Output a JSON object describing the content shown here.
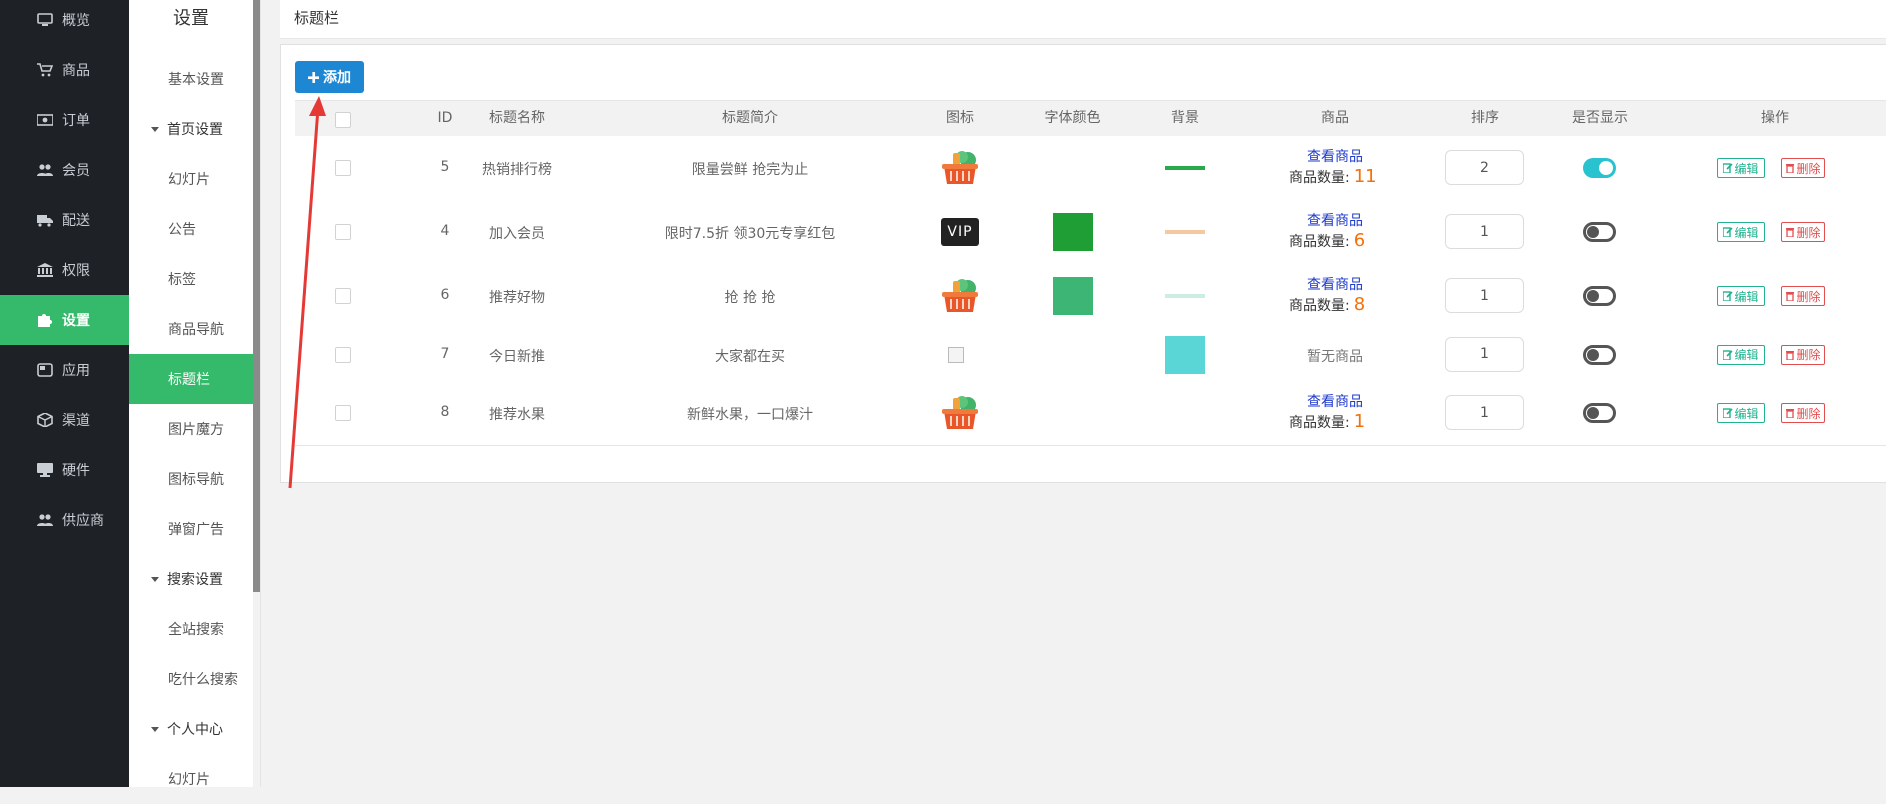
{
  "sidebar": {
    "items": [
      {
        "label": "概览",
        "icon": "monitor-icon"
      },
      {
        "label": "商品",
        "icon": "cart-icon"
      },
      {
        "label": "订单",
        "icon": "money-icon"
      },
      {
        "label": "会员",
        "icon": "users-icon"
      },
      {
        "label": "配送",
        "icon": "truck-icon"
      },
      {
        "label": "权限",
        "icon": "bank-icon"
      },
      {
        "label": "设置",
        "icon": "puzzle-icon",
        "active": true
      },
      {
        "label": "应用",
        "icon": "app-icon"
      },
      {
        "label": "渠道",
        "icon": "cube-icon"
      },
      {
        "label": "硬件",
        "icon": "desktop-icon"
      },
      {
        "label": "供应商",
        "icon": "users-icon"
      }
    ]
  },
  "subnav": {
    "title": "设置",
    "items": [
      {
        "label": "基本设置"
      },
      {
        "label": "首页设置",
        "group": true
      },
      {
        "label": "幻灯片"
      },
      {
        "label": "公告"
      },
      {
        "label": "标签"
      },
      {
        "label": "商品导航"
      },
      {
        "label": "标题栏",
        "active": true
      },
      {
        "label": "图片魔方"
      },
      {
        "label": "图标导航"
      },
      {
        "label": "弹窗广告"
      },
      {
        "label": "搜索设置",
        "group": true
      },
      {
        "label": "全站搜索"
      },
      {
        "label": "吃什么搜索"
      },
      {
        "label": "个人中心",
        "group": true
      },
      {
        "label": "幻灯片"
      }
    ]
  },
  "breadcrumb": "标题栏",
  "toolbar": {
    "add_label": "添加"
  },
  "table": {
    "headers": [
      "ID",
      "标题名称",
      "标题简介",
      "图标",
      "字体颜色",
      "背景",
      "商品",
      "排序",
      "是否显示",
      "操作"
    ],
    "view_goods_label": "查看商品",
    "goods_count_label": "商品数量:",
    "no_goods_label": "暂无商品",
    "edit_label": "编辑",
    "delete_label": "删除",
    "rows": [
      {
        "id": "5",
        "name": "热销排行榜",
        "desc": "限量尝鲜 抢完为止",
        "icon": "basket-icon",
        "font_color": null,
        "bg_color": "#2aa84a",
        "bg_style": "line",
        "goods_count": "11",
        "sort": "2",
        "show": true
      },
      {
        "id": "4",
        "name": "加入会员",
        "desc": "限时7.5折 领30元专享红包",
        "icon": "vip-icon",
        "icon_text": "VIP",
        "font_color": "#1f9e35",
        "bg_color": "#f4c9a0",
        "bg_style": "line",
        "goods_count": "6",
        "sort": "1",
        "show": false
      },
      {
        "id": "6",
        "name": "推荐好物",
        "desc": "抢 抢 抢",
        "icon": "basket-icon",
        "font_color": "#3db574",
        "bg_color": "#cbeee0",
        "bg_style": "line",
        "goods_count": "8",
        "sort": "1",
        "show": false
      },
      {
        "id": "7",
        "name": "今日新推",
        "desc": "大家都在买",
        "icon": "broken-image-icon",
        "font_color": null,
        "bg_color": "#5ad6d6",
        "bg_style": "block",
        "goods_count": null,
        "sort": "1",
        "show": false
      },
      {
        "id": "8",
        "name": "推荐水果",
        "desc": "新鲜水果，一口爆汁",
        "icon": "basket-icon",
        "font_color": null,
        "bg_color": null,
        "bg_style": "none",
        "goods_count": "1",
        "sort": "1",
        "show": false
      }
    ]
  },
  "colors": {
    "accent": "#35b96b",
    "primary_button": "#1e87d4",
    "switch_on": "#29c3cf",
    "count": "#f5700a",
    "link": "#1e3acd",
    "arrow": "#e53935"
  }
}
